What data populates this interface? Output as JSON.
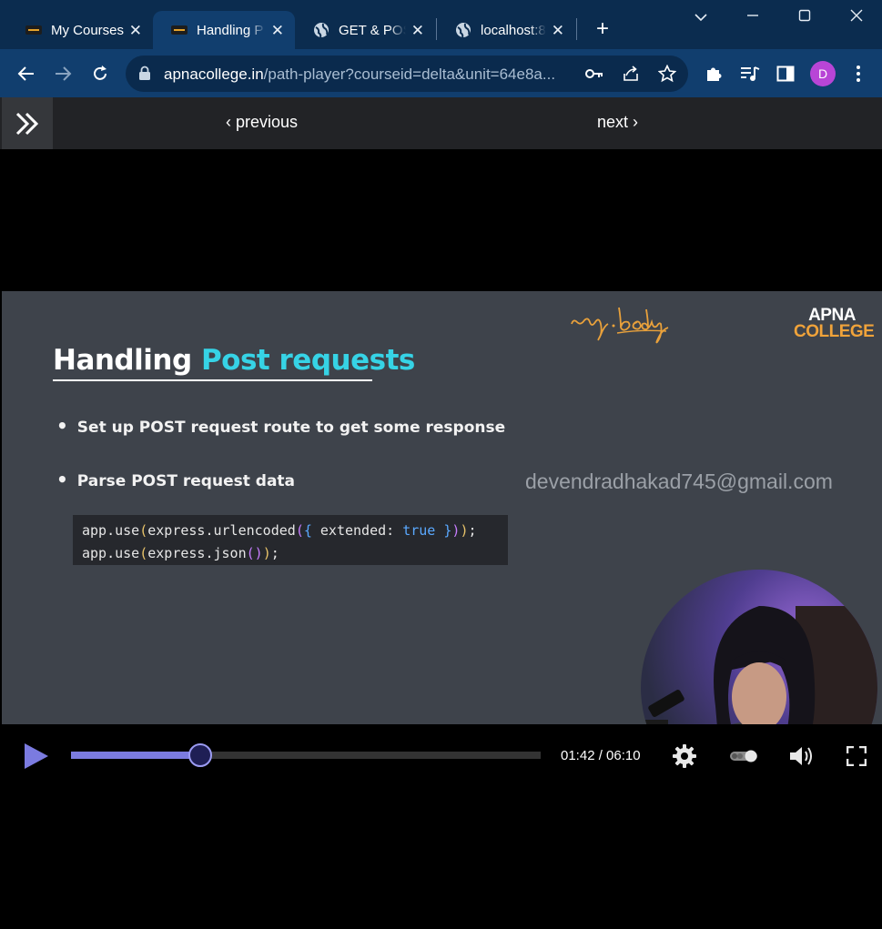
{
  "browser": {
    "tabs": [
      {
        "label": "My Courses",
        "icon": "apna-college-favicon",
        "active": false
      },
      {
        "label": "Handling P",
        "icon": "apna-college-favicon",
        "active": true
      },
      {
        "label": "GET & POS",
        "icon": "globe-icon",
        "active": false
      },
      {
        "label": "localhost:8",
        "icon": "globe-icon",
        "active": false
      }
    ],
    "url_host": "apnacollege.in",
    "url_path": "/path-player?courseid=delta&unit=64e8a...",
    "profile_initial": "D",
    "accent_color": "#113e6e"
  },
  "player_nav": {
    "previous_label": "previous",
    "next_label": "next"
  },
  "slide": {
    "title_plain": "Handling ",
    "title_accent": "Post requests",
    "bullets": [
      "Set up POST request route to get some response",
      "Parse POST request data"
    ],
    "code_line_1": {
      "a": "app.use",
      "b": "(",
      "c": "express.urlencoded",
      "d": "(",
      "e": "{",
      "f": " extended: ",
      "g": "true",
      "h": " }",
      "i": ")",
      "j": ")",
      "k": ";"
    },
    "code_line_2": {
      "a": "app.use",
      "b": "(",
      "c": "express.json",
      "d": "()",
      "e": ")",
      "f": ";"
    },
    "logo_line_1": "APNA",
    "logo_line_2": "COLLEGE",
    "handwritten_note": "req.body",
    "watermark": "devendradhakad745@gmail.com"
  },
  "controls": {
    "time": "01:42 / 06:10",
    "progress": 0.276
  }
}
